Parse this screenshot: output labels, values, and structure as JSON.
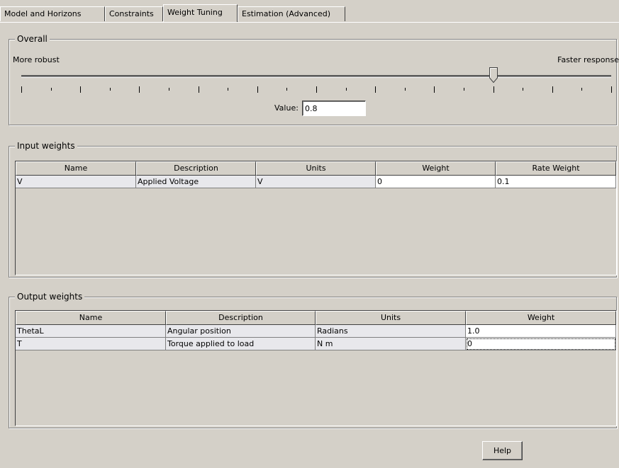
{
  "tabs": [
    {
      "label": "Model and Horizons"
    },
    {
      "label": "Constraints"
    },
    {
      "label": "Weight Tuning"
    },
    {
      "label": "Estimation (Advanced)"
    }
  ],
  "overall": {
    "title": "Overall",
    "left_label": "More robust",
    "right_label": "Faster response",
    "slider_fraction": 0.8,
    "value_label": "Value:",
    "value": "0.8"
  },
  "input_weights": {
    "title": "Input weights",
    "columns": [
      "Name",
      "Description",
      "Units",
      "Weight",
      "Rate Weight"
    ],
    "rows": [
      [
        "V",
        "Applied Voltage",
        "V",
        "0",
        "0.1"
      ]
    ]
  },
  "output_weights": {
    "title": "Output weights",
    "columns": [
      "Name",
      "Description",
      "Units",
      "Weight"
    ],
    "rows": [
      [
        "ThetaL",
        "Angular position",
        "Radians",
        "1.0"
      ],
      [
        "T",
        "Torque applied to load",
        "N m",
        "0"
      ]
    ]
  },
  "help_label": "Help"
}
